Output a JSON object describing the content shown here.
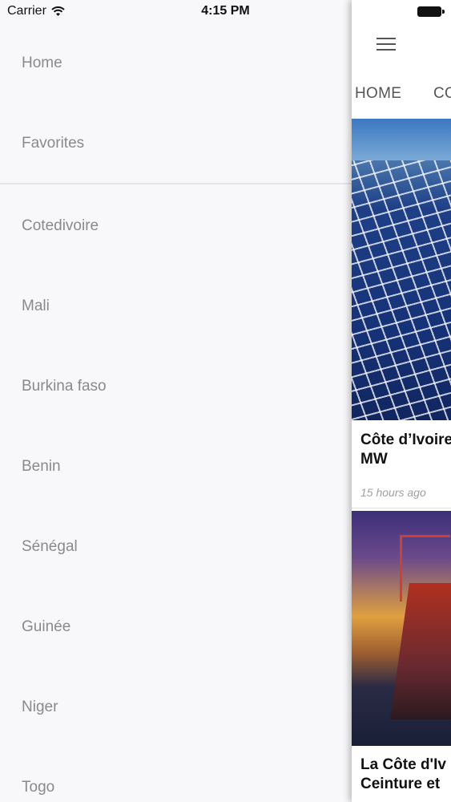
{
  "status_bar": {
    "carrier": "Carrier",
    "time": "4:15 PM"
  },
  "drawer": {
    "primary_items": [
      {
        "label": "Home"
      },
      {
        "label": "Favorites"
      }
    ],
    "country_items": [
      {
        "label": "Cotedivoire"
      },
      {
        "label": "Mali"
      },
      {
        "label": "Burkina faso"
      },
      {
        "label": "Benin"
      },
      {
        "label": "Sénégal"
      },
      {
        "label": "Guinée"
      },
      {
        "label": "Niger"
      },
      {
        "label": "Togo"
      }
    ]
  },
  "main": {
    "tabs": [
      {
        "label": "HOME"
      },
      {
        "label": "CO"
      }
    ],
    "articles": [
      {
        "headline_line1": "Côte d’Ivoire",
        "headline_line2": "MW",
        "time_ago": "15 hours ago",
        "image": "solar-panels"
      },
      {
        "headline_line1": "La Côte d'Iv",
        "headline_line2": "Ceinture et",
        "image": "container-port"
      }
    ]
  },
  "icons": {
    "wifi": "wifi-icon",
    "battery": "battery-icon",
    "menu": "hamburger-menu-icon"
  }
}
